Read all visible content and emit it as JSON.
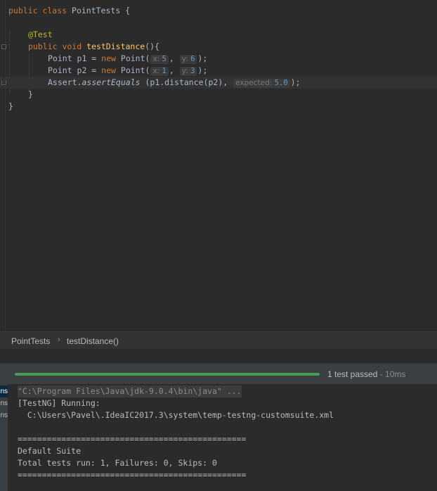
{
  "editor": {
    "lines": [
      {
        "kw": "public class",
        "name": "PointTests",
        "rest": " {"
      },
      {
        "annotation": "@Test"
      },
      {
        "kw": "public void",
        "method": "testDistance",
        "rest": "(){"
      },
      {
        "decl": "Point p1 = ",
        "kw": "new",
        "ctor": "Point(",
        "hint_x": "x:",
        "x": "5",
        "hint_y": "y:",
        "y": "6",
        "end": ");"
      },
      {
        "decl": "Point p2 = ",
        "kw": "new",
        "ctor": "Point(",
        "hint_x": "x:",
        "x": "1",
        "hint_y": "y:",
        "y": "3",
        "end": ");"
      },
      {
        "call_obj": "Assert.",
        "call_fn": "assertEquals",
        "args": " (p1.distance(p2),",
        "hint_expected": "expected:",
        "expected": "5.0",
        "end": ");"
      },
      {
        "text": "}"
      },
      {
        "text": "}"
      }
    ]
  },
  "breadcrumb": {
    "items": [
      "PointTests",
      "testDistance()"
    ],
    "separator": "›"
  },
  "runner": {
    "progress": 1.0,
    "progress_color": "#499c54",
    "status": "1 test passed",
    "duration": " - 10ms"
  },
  "console": {
    "side_tabs": [
      "ns",
      "ns",
      "ns"
    ],
    "lines": [
      "\"C:\\Program Files\\Java\\jdk-9.0.4\\bin\\java\" ...",
      "[TestNG] Running:",
      "  C:\\Users\\Pavel\\.IdeaIC2017.3\\system\\temp-testng-customsuite.xml",
      "",
      "===============================================",
      "Default Suite",
      "Total tests run: 1, Failures: 0, Skips: 0",
      "==============================================="
    ]
  }
}
